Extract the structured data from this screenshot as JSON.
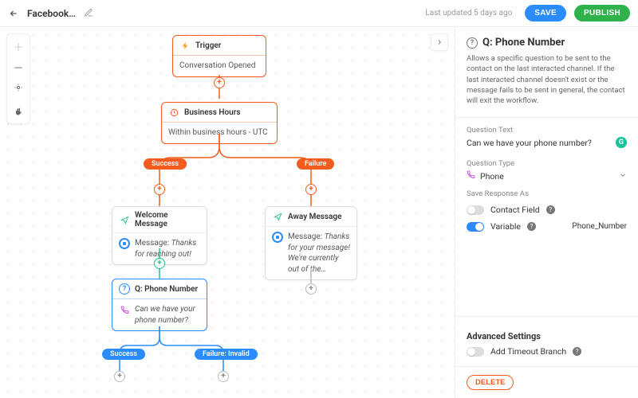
{
  "header": {
    "workflow_name": "Facebook…",
    "last_updated": "Last updated 5 days ago",
    "save_label": "SAVE",
    "publish_label": "PUBLISH"
  },
  "nodes": {
    "trigger": {
      "title": "Trigger",
      "body": "Conversation Opened"
    },
    "hours": {
      "title": "Business Hours",
      "body": "Within business hours - UTC"
    },
    "welcome": {
      "title": "Welcome Message",
      "body_prefix": "Message: ",
      "body_text": "Thanks for reaching out!"
    },
    "away": {
      "title": "Away Message",
      "body_prefix": "Message: ",
      "body_text": "Thanks for your message! We're currently out of the…"
    },
    "question": {
      "title": "Q: Phone Number",
      "body_text": "Can we have your phone number?"
    }
  },
  "branches": {
    "hours_success": "Success",
    "hours_failure": "Failure",
    "q_success": "Success",
    "q_failure": "Failure: Invalid"
  },
  "inspector": {
    "title": "Q: Phone Number",
    "description": "Allows a specific question to be sent to the contact on the last interacted channel. If the last interacted channel doesn't exist or the message fails to be sent in general, the contact will exit the workflow.",
    "question_text_label": "Question Text",
    "question_text_value": "Can we have your phone number?",
    "question_type_label": "Question Type",
    "question_type_value": "Phone",
    "save_response_label": "Save Response As",
    "contact_field_label": "Contact Field",
    "variable_label": "Variable",
    "variable_value": "Phone_Number",
    "advanced_label": "Advanced Settings",
    "timeout_label": "Add Timeout Branch",
    "delete_label": "DELETE"
  }
}
